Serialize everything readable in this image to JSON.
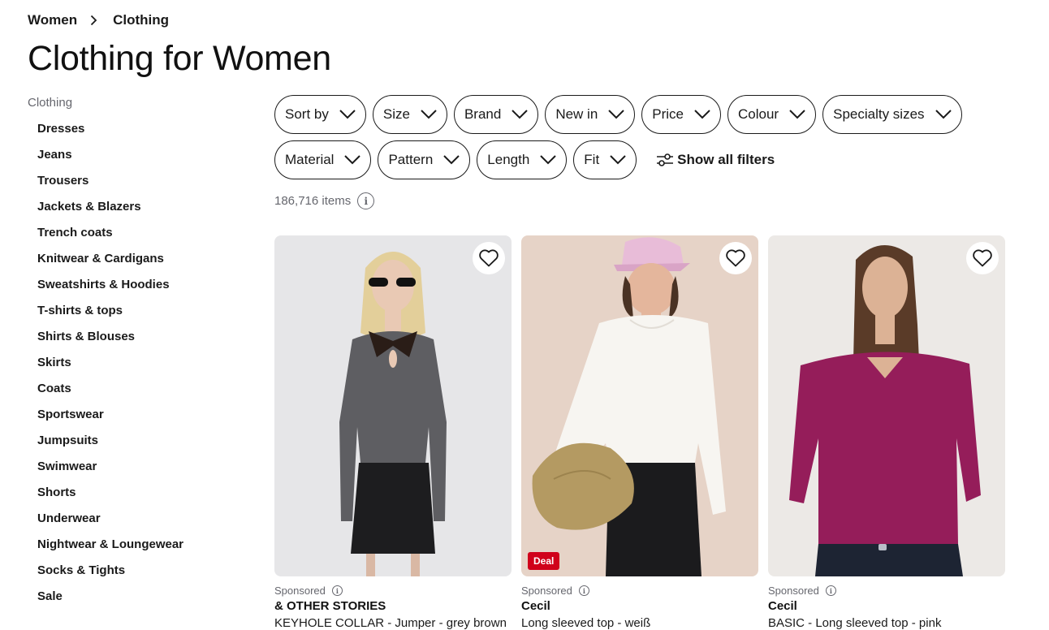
{
  "breadcrumb": {
    "items": [
      "Women",
      "Clothing"
    ]
  },
  "page_title": "Clothing for Women",
  "sidebar": {
    "heading": "Clothing",
    "items": [
      {
        "label": "Dresses"
      },
      {
        "label": "Jeans"
      },
      {
        "label": "Trousers"
      },
      {
        "label": "Jackets & Blazers"
      },
      {
        "label": "Trench coats"
      },
      {
        "label": "Knitwear & Cardigans"
      },
      {
        "label": "Sweatshirts & Hoodies"
      },
      {
        "label": "T-shirts & tops"
      },
      {
        "label": "Shirts & Blouses"
      },
      {
        "label": "Skirts"
      },
      {
        "label": "Coats"
      },
      {
        "label": "Sportswear"
      },
      {
        "label": "Jumpsuits"
      },
      {
        "label": "Swimwear"
      },
      {
        "label": "Shorts"
      },
      {
        "label": "Underwear"
      },
      {
        "label": "Nightwear & Loungewear"
      },
      {
        "label": "Socks & Tights"
      },
      {
        "label": "Sale"
      }
    ]
  },
  "filters": {
    "row1": [
      "Sort by",
      "Size",
      "Brand",
      "New in",
      "Price",
      "Colour",
      "Specialty sizes"
    ],
    "row2": [
      "Material",
      "Pattern",
      "Length",
      "Fit"
    ],
    "show_all_label": "Show all filters"
  },
  "results": {
    "count_text": "186,716 items",
    "info_icon": "info-icon"
  },
  "products": [
    {
      "sponsored": "Sponsored",
      "brand": "& OTHER STORIES",
      "name": "KEYHOLE COLLAR - Jumper - grey brown",
      "badge": "",
      "colors": {
        "bg": "#e6e6e8",
        "garment": "#5e5e62",
        "skirt": "#1d1d1f",
        "hair": "#e3cf9a",
        "skin": "#e9c9b4"
      }
    },
    {
      "sponsored": "Sponsored",
      "brand": "Cecil",
      "name": "Long sleeved top - weiß",
      "badge": "Deal",
      "colors": {
        "bg": "#e6d3c7",
        "garment": "#f7f5f1",
        "pants": "#1b1b1d",
        "cap": "#e8bcd8",
        "bag": "#b49a62",
        "skin": "#e4b69c"
      }
    },
    {
      "sponsored": "Sponsored",
      "brand": "Cecil",
      "name": "BASIC - Long sleeved top - pink",
      "badge": "",
      "colors": {
        "bg": "#ece9e6",
        "garment": "#951d5a",
        "pants": "#1d2433",
        "hair": "#5a3b28",
        "skin": "#dcb295"
      }
    }
  ],
  "accent": {
    "deal_red": "#d0021b",
    "text_muted": "#66676e"
  }
}
